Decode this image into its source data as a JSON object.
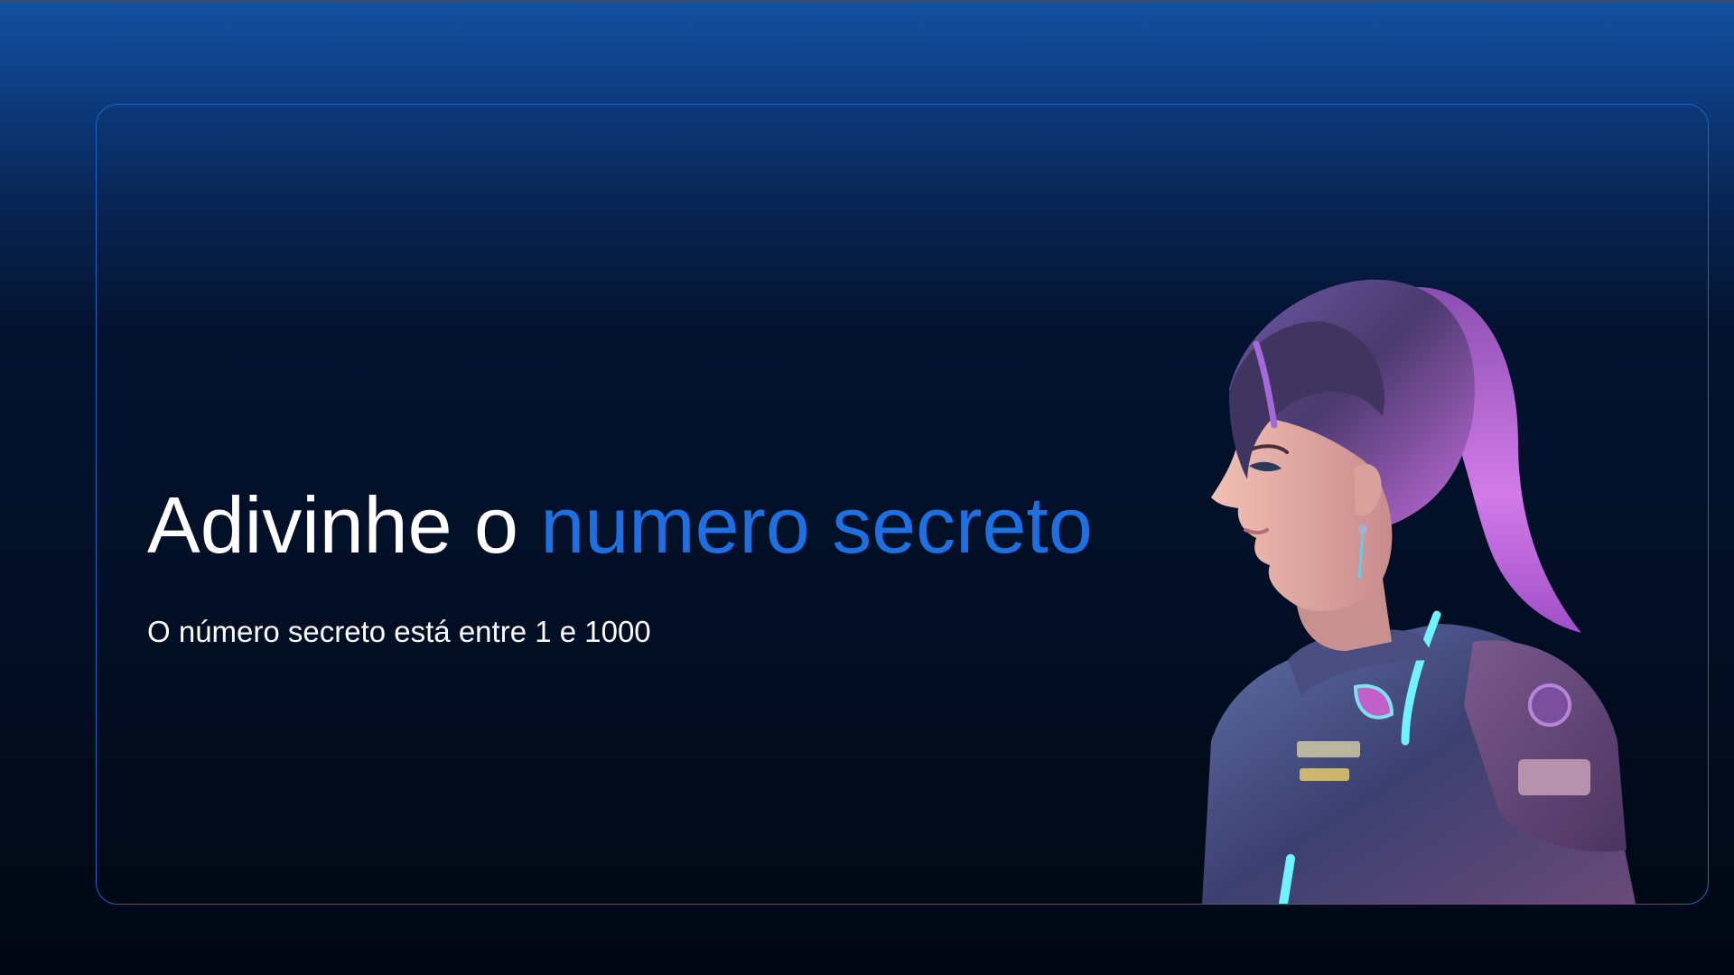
{
  "page": {
    "title_prefix": "Adivinhe o",
    "title_highlight": "numero secreto",
    "subtitle": "O número secreto está entre 1 e 1000"
  },
  "illustration": {
    "name": "astronaut-woman-illustration"
  },
  "colors": {
    "accent": "#1e6fe0",
    "border": "#1f63c8",
    "text": "#ffffff",
    "background_top": "#1352a2",
    "background_bottom": "#010814"
  }
}
